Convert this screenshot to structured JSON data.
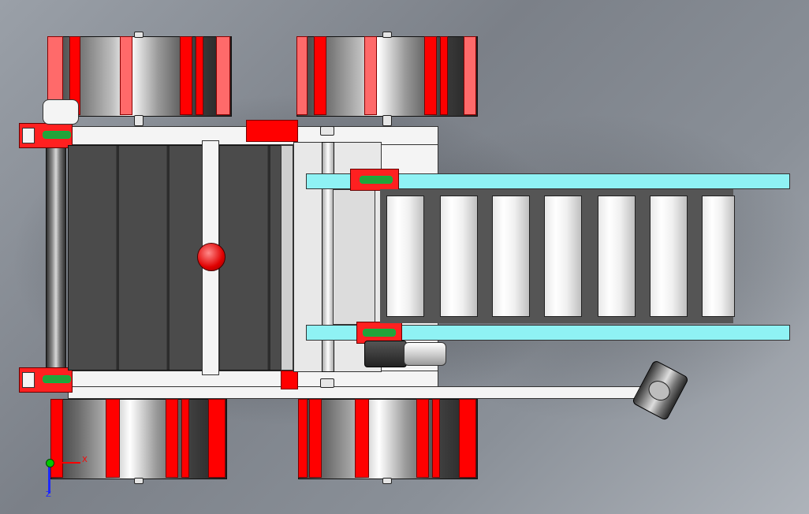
{
  "viewport": {
    "triad": {
      "x_label": "X",
      "z_label": "Z",
      "colors": {
        "x": "#ff0000",
        "y": "#00c800",
        "z": "#1e28ff"
      }
    }
  },
  "model": {
    "colors": {
      "wheel_hub": "#ff0000",
      "rail": "#8ff2f4",
      "belt": "#4b4b4b",
      "bearing": "#ff2020",
      "frame": "#f4f4f4"
    },
    "components": [
      "wheel-front-left",
      "wheel-front-right",
      "wheel-rear-left",
      "wheel-rear-right",
      "main-belt",
      "roller-conveyor",
      "side-rail-top",
      "side-rail-bottom",
      "drive-motor",
      "red-knob",
      "end-shaft-left",
      "idler-assembly"
    ]
  }
}
